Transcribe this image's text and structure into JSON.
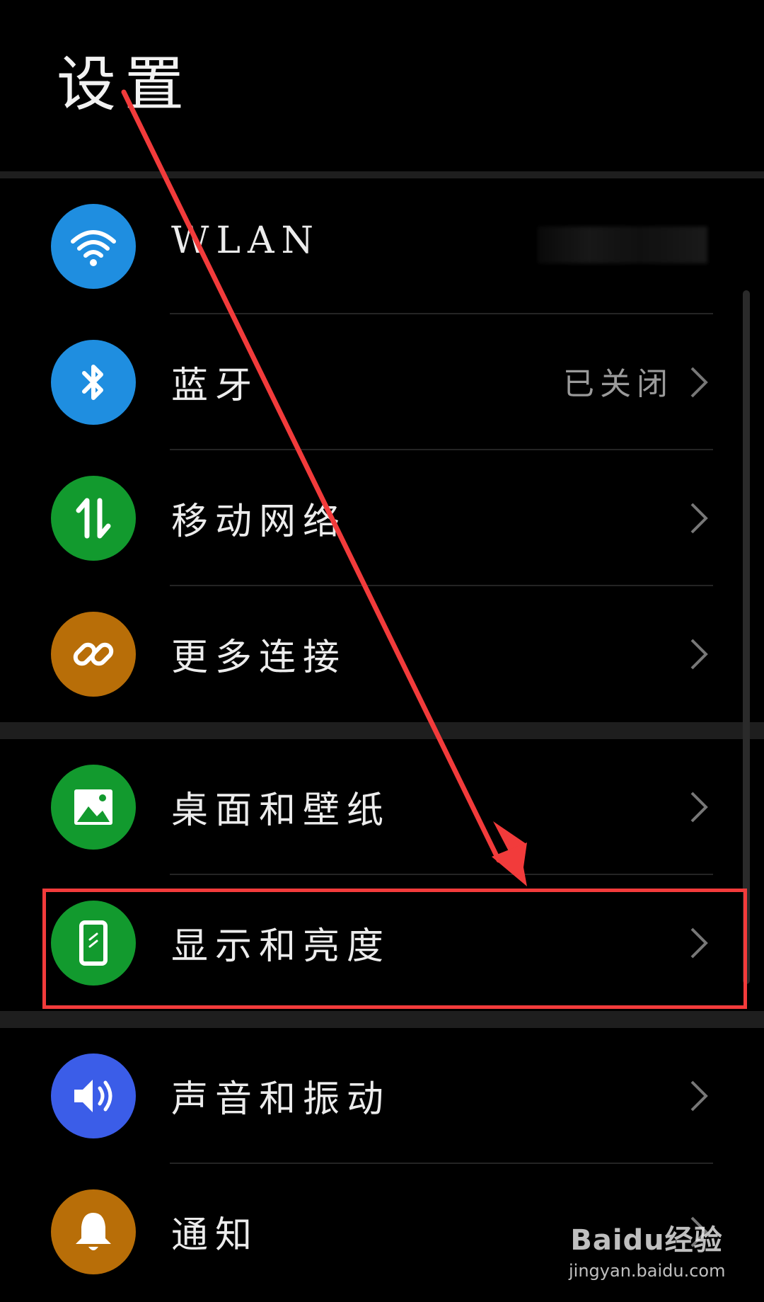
{
  "header": {
    "title": "设置"
  },
  "rows": [
    {
      "label": "WLAN",
      "value": "",
      "icon": "wifi-icon",
      "color": "#1f8ee0"
    },
    {
      "label": "蓝牙",
      "value": "已关闭",
      "icon": "bluetooth-icon",
      "color": "#1f8ee0"
    },
    {
      "label": "移动网络",
      "value": "",
      "icon": "mobile-data-icon",
      "color": "#129a2e"
    },
    {
      "label": "更多连接",
      "value": "",
      "icon": "link-icon",
      "color": "#b86e08"
    },
    {
      "label": "桌面和壁纸",
      "value": "",
      "icon": "image-icon",
      "color": "#129a2e"
    },
    {
      "label": "显示和亮度",
      "value": "",
      "icon": "phone-display-icon",
      "color": "#129a2e"
    },
    {
      "label": "声音和振动",
      "value": "",
      "icon": "speaker-icon",
      "color": "#3b5de8"
    },
    {
      "label": "通知",
      "value": "",
      "icon": "bell-icon",
      "color": "#b86e08"
    }
  ],
  "annotation": {
    "color": "#f23b3b"
  },
  "watermark": {
    "logo": "Baidu经验",
    "url": "jingyan.baidu.com"
  }
}
